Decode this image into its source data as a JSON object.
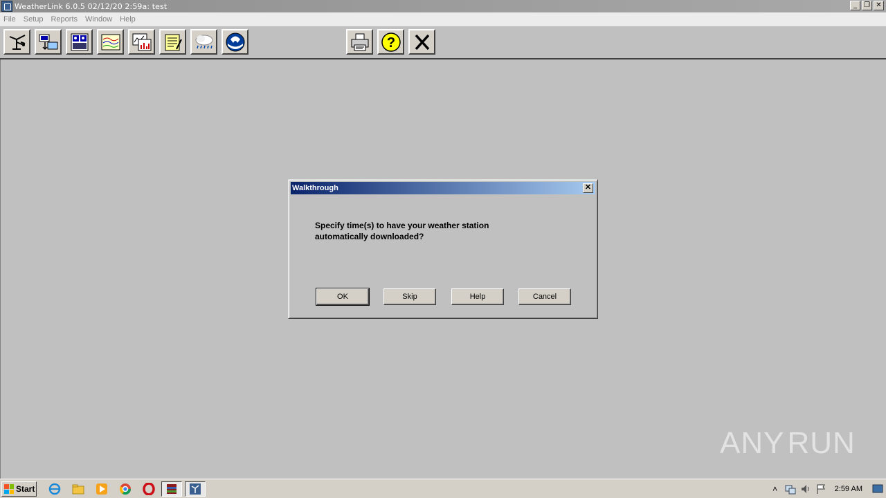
{
  "window": {
    "title": "WeatherLink 6.0.5  02/12/20  2:59a: test",
    "controls": {
      "minimize": "_",
      "restore": "❐",
      "close": "✕"
    }
  },
  "menu": {
    "items": [
      "File",
      "Setup",
      "Reports",
      "Window",
      "Help"
    ]
  },
  "toolbar": {
    "buttons": [
      {
        "name": "station-icon"
      },
      {
        "name": "download-icon"
      },
      {
        "name": "bulletin-icon"
      },
      {
        "name": "plot-icon"
      },
      {
        "name": "strip-chart-icon"
      },
      {
        "name": "notes-icon"
      },
      {
        "name": "weather-icon"
      },
      {
        "name": "noaa-icon"
      },
      {
        "name": "print-icon"
      },
      {
        "name": "help-icon"
      },
      {
        "name": "exit-icon"
      }
    ],
    "noaa_text": "NOAA",
    "help_glyph": "?",
    "exit_glyph": "✕"
  },
  "dialog": {
    "title": "Walkthrough",
    "close": "✕",
    "message": "Specify time(s) to have your weather station\nautomatically downloaded?",
    "buttons": {
      "ok": "OK",
      "skip": "Skip",
      "help": "Help",
      "cancel": "Cancel"
    }
  },
  "watermark": {
    "left": "ANY",
    "right": "RUN"
  },
  "taskbar": {
    "start": "Start",
    "clock": "2:59 AM",
    "tray_chevron": "˄"
  },
  "colors": {
    "dialog_title_start": "#0a246a",
    "dialog_title_end": "#a6caf0",
    "background": "#c0c0c0"
  }
}
